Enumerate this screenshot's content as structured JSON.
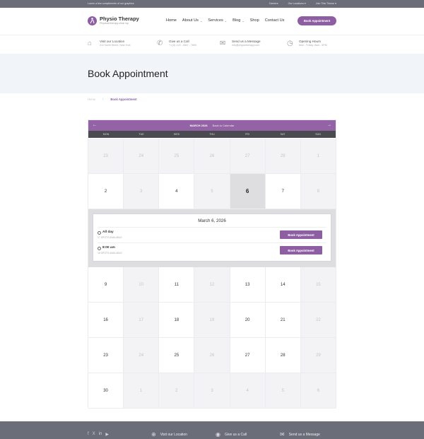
{
  "topbar": {
    "tagline": "Lorem a few compliments of our graphics",
    "links": [
      "Careers",
      "Our Locations",
      "Join This Theme"
    ]
  },
  "header": {
    "logo_title": "Physio Therapy",
    "logo_tagline": "Physical therapy clinic wp",
    "nav": [
      {
        "label": "Home",
        "dropdown": false
      },
      {
        "label": "About Us",
        "dropdown": true
      },
      {
        "label": "Services",
        "dropdown": true
      },
      {
        "label": "Blog",
        "dropdown": true
      },
      {
        "label": "Shop",
        "dropdown": false
      },
      {
        "label": "Contact Us",
        "dropdown": false
      }
    ],
    "cta": "Book Appointment"
  },
  "info": [
    {
      "icon": "home-icon",
      "title": "Visit our Location",
      "sub": "210 North Street, New York"
    },
    {
      "icon": "phone-icon",
      "title": "Give us a Call",
      "sub": "+1 (5) 123 - 4567 - 7890"
    },
    {
      "icon": "mail-icon",
      "title": "Send us a Message",
      "sub": "info@physiotherapy.com"
    },
    {
      "icon": "clock-icon",
      "title": "Opening Hours",
      "sub": "Mon - Friday: 8am - 5PM"
    }
  ],
  "page": {
    "title": "Book Appointment",
    "breadcrumb_home": "Home",
    "breadcrumb_sep": "/",
    "breadcrumb_current": "Book Appointment"
  },
  "calendar": {
    "month": "MARCH 2026",
    "back": "Back to Calendar",
    "weekdays": [
      "MON",
      "TUE",
      "WED",
      "THU",
      "FRI",
      "SAT",
      "SUN"
    ],
    "weeks": [
      [
        {
          "d": "23",
          "m": true
        },
        {
          "d": "24",
          "m": true
        },
        {
          "d": "25",
          "m": true
        },
        {
          "d": "26",
          "m": true
        },
        {
          "d": "27",
          "m": true
        },
        {
          "d": "28",
          "m": true
        },
        {
          "d": "1",
          "m": true
        }
      ],
      [
        {
          "d": "2",
          "m": false
        },
        {
          "d": "3",
          "m": true
        },
        {
          "d": "4",
          "m": false
        },
        {
          "d": "5",
          "m": true
        },
        {
          "d": "6",
          "m": false,
          "sel": true
        },
        {
          "d": "7",
          "m": false
        },
        {
          "d": "8",
          "m": true
        }
      ],
      [
        {
          "d": "9",
          "m": false
        },
        {
          "d": "10",
          "m": true
        },
        {
          "d": "11",
          "m": false
        },
        {
          "d": "12",
          "m": true
        },
        {
          "d": "13",
          "m": false
        },
        {
          "d": "14",
          "m": false
        },
        {
          "d": "15",
          "m": true
        }
      ],
      [
        {
          "d": "16",
          "m": false
        },
        {
          "d": "17",
          "m": true
        },
        {
          "d": "18",
          "m": false
        },
        {
          "d": "19",
          "m": true
        },
        {
          "d": "20",
          "m": false
        },
        {
          "d": "21",
          "m": false
        },
        {
          "d": "22",
          "m": true
        }
      ],
      [
        {
          "d": "23",
          "m": false
        },
        {
          "d": "24",
          "m": true
        },
        {
          "d": "25",
          "m": false
        },
        {
          "d": "26",
          "m": true
        },
        {
          "d": "27",
          "m": false
        },
        {
          "d": "28",
          "m": false
        },
        {
          "d": "29",
          "m": true
        }
      ],
      [
        {
          "d": "30",
          "m": false
        },
        {
          "d": "1",
          "m": true
        },
        {
          "d": "2",
          "m": true
        },
        {
          "d": "3",
          "m": true
        },
        {
          "d": "4",
          "m": true
        },
        {
          "d": "5",
          "m": true
        },
        {
          "d": "6",
          "m": true
        }
      ]
    ],
    "events": {
      "date": "March 6, 2026",
      "items": [
        {
          "time": "All day",
          "spots": "17 SPOTS AVAILABLE",
          "cta": "Book Appointment"
        },
        {
          "time": "8:00 am",
          "spots": "18 SPOTS AVAILABLE",
          "cta": "Book Appointment"
        }
      ]
    }
  },
  "footer": {
    "social": [
      "f",
      "X",
      "in",
      "▶"
    ],
    "items": [
      {
        "icon": "location-icon",
        "label": "Visit our Location"
      },
      {
        "icon": "pin-icon",
        "label": "Give us a Call"
      },
      {
        "icon": "mail-icon",
        "label": "Send us a Message"
      }
    ]
  }
}
